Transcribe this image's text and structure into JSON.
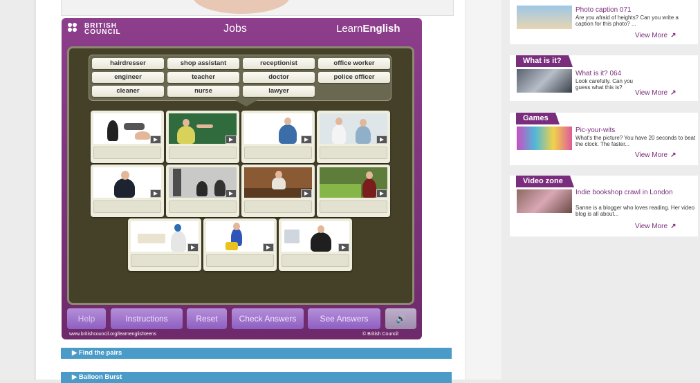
{
  "activity": {
    "title": "Jobs",
    "logo": "BRITISH COUNCIL",
    "logo_line1": "BRITISH",
    "logo_line2": "COUNCIL",
    "brand_light": "Learn",
    "brand_bold": "English",
    "words": [
      "hairdresser",
      "shop assistant",
      "receptionist",
      "office worker",
      "engineer",
      "teacher",
      "doctor",
      "police officer",
      "cleaner",
      "nurse",
      "lawyer"
    ],
    "controls": {
      "help": "Help",
      "instructions": "Instructions",
      "reset": "Reset",
      "check": "Check Answers",
      "see": "See Answers",
      "sound_icon": "speaker-icon"
    },
    "url": "www.britishcouncil.org/learnenglishteens",
    "copyright": "© British Council"
  },
  "accordion": {
    "item1": "Find the pairs",
    "item2": "Balloon Burst"
  },
  "sidebar": {
    "photo": {
      "title": "Photo caption 071",
      "desc": "Are you afraid of heights? Can you write a caption for this photo? ...",
      "more": "View More"
    },
    "what": {
      "tab": "What is it?",
      "title": "What is it? 064",
      "desc": "Look carefully. Can you guess what this is?",
      "more": "View More"
    },
    "games": {
      "tab": "Games",
      "title": "Pic-your-wits",
      "desc": "What's the picture? You have 20 seconds to beat the clock. The faster...",
      "more": "View More"
    },
    "video": {
      "tab": "Video zone",
      "title": "Indie bookshop crawl in London",
      "desc": "Sanne is a blogger who loves reading. Her video blog is all about...",
      "more": "View More"
    }
  },
  "colors": {
    "purple": "#7a2d7d",
    "blue_bar": "#4a9bc7",
    "board": "#454129"
  }
}
